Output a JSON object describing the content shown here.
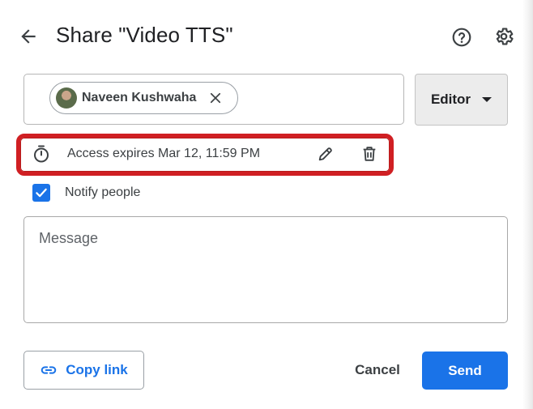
{
  "dialog": {
    "title": "Share \"Video TTS\""
  },
  "recipient": {
    "chip_name": "Naveen Kushwaha"
  },
  "role": {
    "selected": "Editor"
  },
  "access": {
    "expiry_text": "Access expires Mar 12, 11:59 PM"
  },
  "notify": {
    "label": "Notify people",
    "checked": true
  },
  "message": {
    "placeholder": "Message"
  },
  "footer": {
    "copy_link_label": "Copy link",
    "cancel_label": "Cancel",
    "send_label": "Send"
  },
  "colors": {
    "accent": "#1a73e8",
    "highlight": "#d01f23"
  },
  "icons": {
    "back": "arrow-back-icon",
    "help": "help-icon",
    "settings": "gear-icon",
    "chip_remove": "close-icon",
    "dropdown": "caret-down-icon",
    "timer": "timer-icon",
    "edit": "pencil-icon",
    "delete": "trash-icon",
    "check": "check-icon",
    "link": "link-icon"
  }
}
